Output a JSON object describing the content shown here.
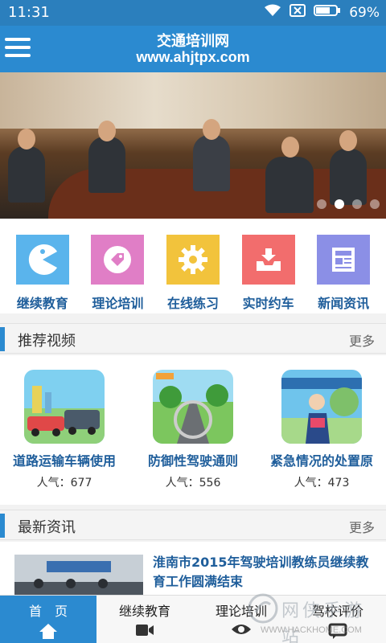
{
  "status_bar": {
    "time": "11:31",
    "battery": "69%",
    "icons": [
      "wifi-icon",
      "sim-off-icon",
      "battery-icon"
    ]
  },
  "header": {
    "title": "交通培训网",
    "url": "www.ahjtpx.com",
    "menu_icon": "hamburger-icon"
  },
  "banner": {
    "slide_count": 4,
    "active_slide": 2
  },
  "nav": [
    {
      "label": "继续教育",
      "icon": "pacman-icon",
      "color": "#5ab4ec"
    },
    {
      "label": "理论培训",
      "icon": "tag-icon",
      "color": "#e07ec6"
    },
    {
      "label": "在线练习",
      "icon": "gear-icon",
      "color": "#f2c33c"
    },
    {
      "label": "实时约车",
      "icon": "download-tray-icon",
      "color": "#f26d6d"
    },
    {
      "label": "新闻资讯",
      "icon": "newspaper-icon",
      "color": "#8b8fe6"
    }
  ],
  "videos_section": {
    "title": "推荐视频",
    "more": "更多",
    "items": [
      {
        "title": "道路运输车辆使用",
        "popularity": "人气：677"
      },
      {
        "title": "防御性驾驶通则",
        "popularity": "人气：556"
      },
      {
        "title": "紧急情况的处置原",
        "popularity": "人气：473"
      }
    ]
  },
  "news_section": {
    "title": "最新资讯",
    "more": "更多",
    "items": [
      {
        "title": "淮南市2015年驾驶培训教练员继续教育工作圆满结束"
      }
    ]
  },
  "tabbar": [
    {
      "label": "首　页",
      "icon": "home-icon",
      "active": true
    },
    {
      "label": "继续教育",
      "icon": "video-camera-icon",
      "active": false
    },
    {
      "label": "理论培训",
      "icon": "eye-icon",
      "active": false
    },
    {
      "label": "驾校评价",
      "icon": "chat-icon",
      "active": false
    }
  ],
  "watermark": {
    "name": "网侠手游站",
    "url": "WWW.HACKHOME.COM"
  },
  "colors": {
    "primary": "#2b8ad0",
    "link": "#1f5e9b"
  }
}
